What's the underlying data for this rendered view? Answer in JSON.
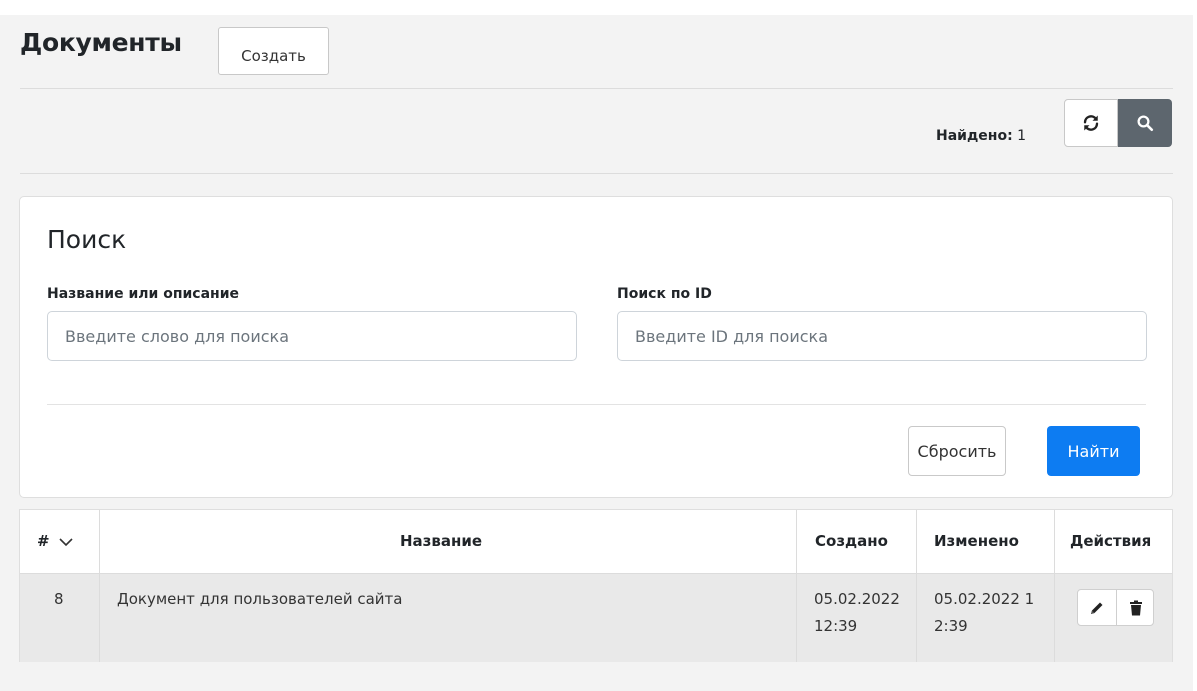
{
  "header": {
    "title": "Документы",
    "create_label": "Создать"
  },
  "toolbar": {
    "found_label": "Найдено:",
    "found_count": "1",
    "refresh_icon": "refresh-icon",
    "search_icon": "search-icon"
  },
  "search": {
    "title": "Поиск",
    "name_label": "Название или описание",
    "name_placeholder": "Введите слово для поиска",
    "name_value": "",
    "id_label": "Поиск по ID",
    "id_placeholder": "Введите ID для поиска",
    "id_value": "",
    "reset_label": "Сбросить",
    "find_label": "Найти"
  },
  "table": {
    "columns": [
      {
        "key": "id",
        "label": "#"
      },
      {
        "key": "name",
        "label": "Название"
      },
      {
        "key": "created",
        "label": "Создано"
      },
      {
        "key": "modified",
        "label": "Изменено"
      },
      {
        "key": "actions",
        "label": "Действия"
      }
    ],
    "rows": [
      {
        "id": "8",
        "name": "Документ для пользователей сайта",
        "created_1": "05.02.2022",
        "created_2": "12:39",
        "modified_1": "05.02.2022 1",
        "modified_2": "2:39"
      }
    ]
  },
  "colors": {
    "primary": "#0d7cf2",
    "secondary": "#5d666e",
    "background": "#f3f3f3"
  }
}
